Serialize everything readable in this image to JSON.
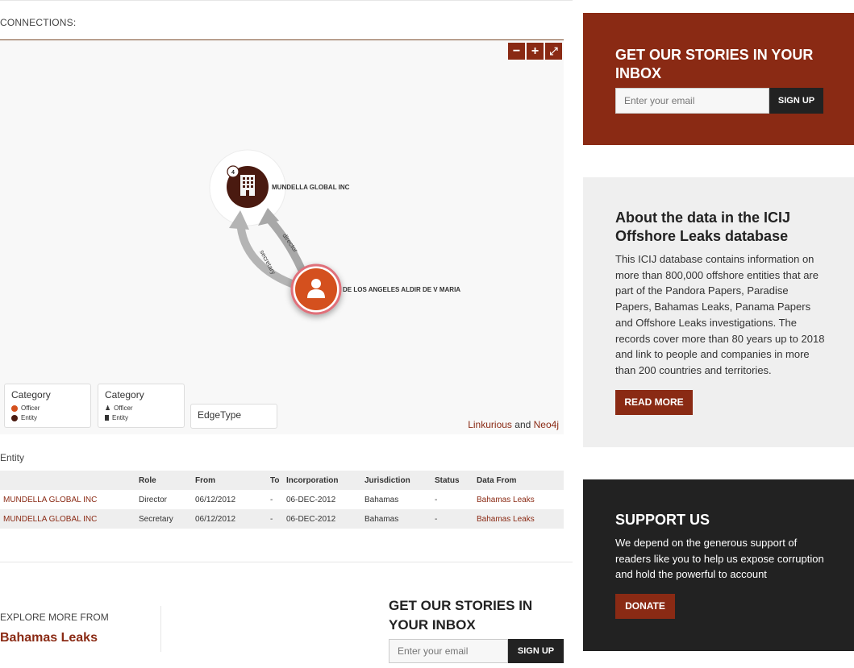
{
  "connections_label": "CONNECTIONS:",
  "graph": {
    "zoom_out": "−",
    "zoom_in": "+",
    "fullscreen": "⤢",
    "entity_node_label": "MUNDELLA GLOBAL INC",
    "entity_badge": "4",
    "officer_node_label": "DE LOS ANGELES ALDIR DE V MARIA",
    "edge_director": "director",
    "edge_secretary": "secretary",
    "legend1": {
      "title": "Category",
      "items": [
        "Officer",
        "Entity"
      ],
      "colors": [
        "#d4501e",
        "#4a1a10"
      ]
    },
    "legend2": {
      "title": "Category",
      "items": [
        "Officer",
        "Entity"
      ]
    },
    "legend3": {
      "title": "EdgeType"
    },
    "credit": {
      "link1": "Linkurious",
      "and": "and",
      "link2": "Neo4j"
    }
  },
  "entity_section": {
    "label": "Entity",
    "columns": [
      "",
      "Role",
      "From",
      "To",
      "Incorporation",
      "Jurisdiction",
      "Status",
      "Data From"
    ],
    "rows": [
      [
        "MUNDELLA GLOBAL INC",
        "Director",
        "06/12/2012",
        "-",
        "06-DEC-2012",
        "Bahamas",
        "-",
        "Bahamas Leaks"
      ],
      [
        "MUNDELLA GLOBAL INC",
        "Secretary",
        "06/12/2012",
        "-",
        "06-DEC-2012",
        "Bahamas",
        "-",
        "Bahamas Leaks"
      ]
    ]
  },
  "explore": {
    "label": "EXPLORE MORE FROM",
    "link": "Bahamas Leaks"
  },
  "footer_signup": {
    "title": "GET OUR STORIES IN YOUR INBOX",
    "placeholder": "Enter your email",
    "button": "SIGN UP"
  },
  "sidebar": {
    "signup": {
      "title": "GET OUR STORIES IN YOUR INBOX",
      "placeholder": "Enter your email",
      "button": "SIGN UP",
      "color": "#8a2a14"
    },
    "about": {
      "title": "About the data in the ICIJ Offshore Leaks database",
      "text": "This ICIJ database contains information on more than 800,000 offshore entities that are part of the Pandora Papers, Paradise Papers, Bahamas Leaks, Panama Papers and Offshore Leaks investigations. The records cover more than 80 years up to 2018 and link to people and companies in more than 200 countries and territories.",
      "button": "READ MORE"
    },
    "support": {
      "title": "SUPPORT US",
      "text": "We depend on the generous support of readers like you to help us expose corruption and hold the powerful to account",
      "button": "DONATE"
    }
  }
}
